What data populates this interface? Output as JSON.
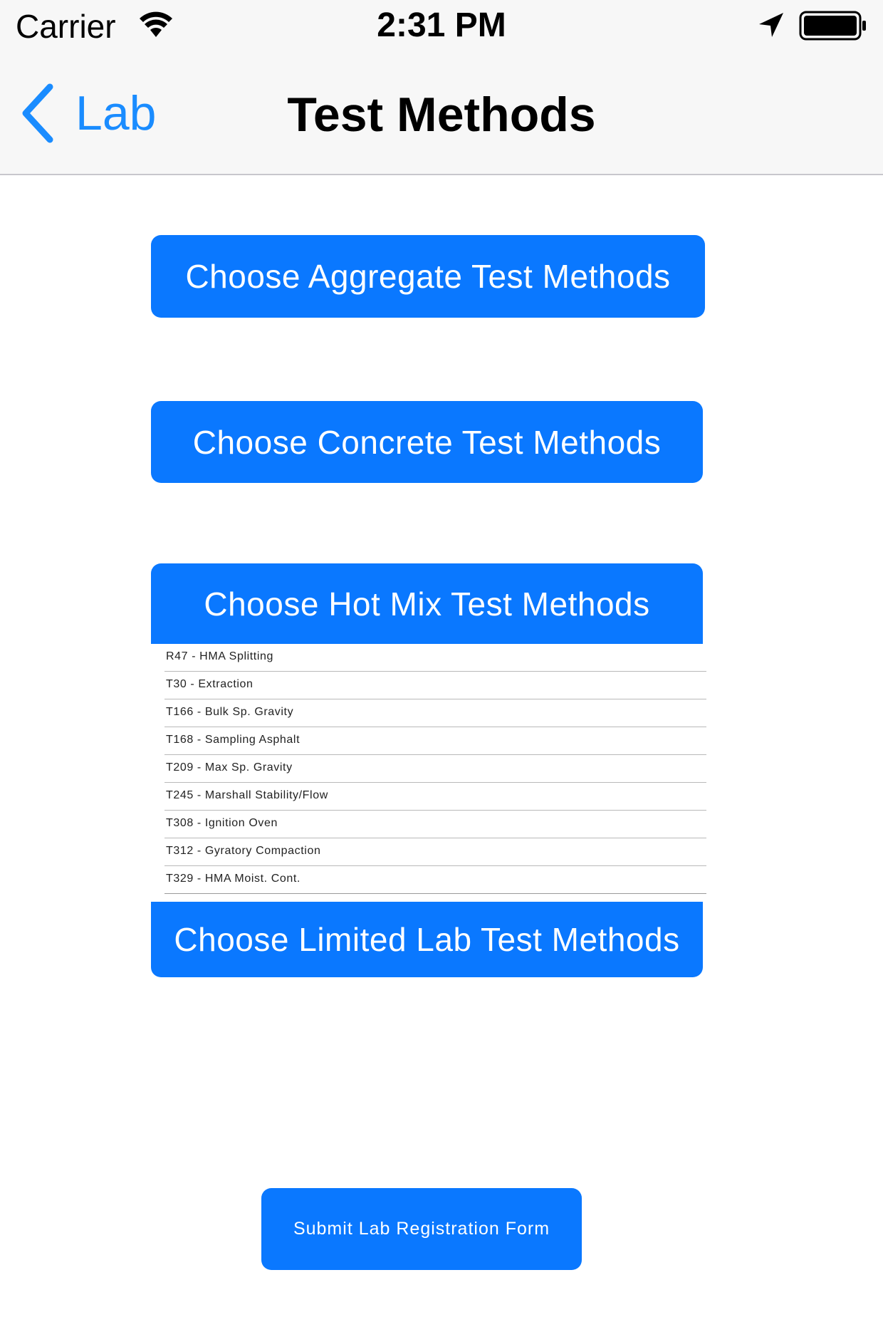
{
  "status_bar": {
    "carrier": "Carrier",
    "time": "2:31 PM",
    "icons": [
      "wifi-icon",
      "location-arrow-icon",
      "battery-icon"
    ]
  },
  "nav": {
    "back_label": "Lab",
    "title": "Test Methods",
    "accent_color": "#1a8cff"
  },
  "buttons": {
    "aggregate": "Choose Aggregate Test Methods",
    "concrete": "Choose Concrete Test Methods",
    "hot_mix": "Choose Hot Mix Test Methods",
    "limited_lab": "Choose Limited Lab Test Methods",
    "submit": "Submit Lab Registration Form",
    "color": "#0a78ff"
  },
  "hot_mix_options": [
    "R47 - HMA Splitting",
    "T30 - Extraction",
    "T166 - Bulk Sp. Gravity",
    "T168 - Sampling Asphalt",
    "T209 - Max Sp. Gravity",
    "T245 - Marshall Stability/Flow",
    "T308 - Ignition Oven",
    "T312 - Gyratory Compaction",
    "T329 - HMA Moist. Cont."
  ]
}
